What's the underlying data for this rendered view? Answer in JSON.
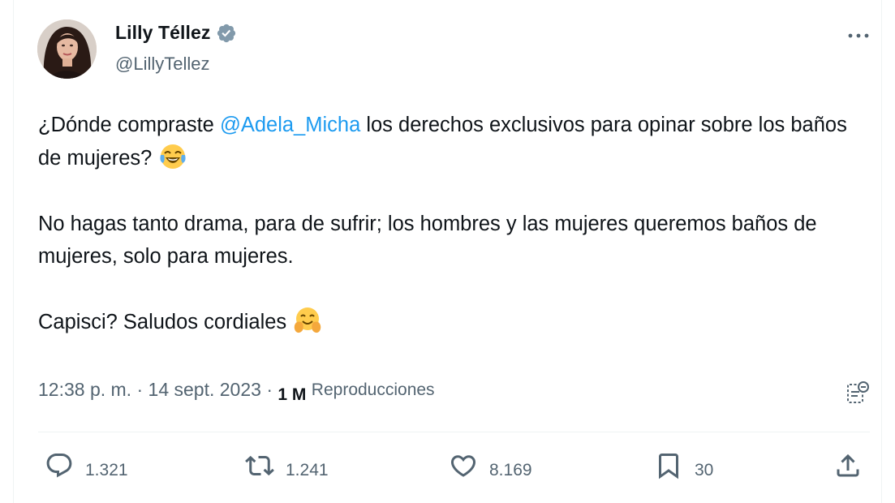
{
  "author": {
    "display_name": "Lilly Téllez",
    "handle": "@LillyTellez",
    "avatar_icon": "profile-photo",
    "verified_icon": "verified-badge-icon"
  },
  "tweet": {
    "p1_before": "¿Dónde compraste ",
    "p1_mention": "@Adela_Micha",
    "p1_after": " los derechos exclusivos para opinar sobre los baños de mujeres?",
    "p1_emoji": "face-with-tears-of-joy",
    "p2": "No hagas tanto drama, para de sufrir; los hombres y las mujeres queremos baños de mujeres, solo para mujeres.",
    "p3": "Capisci? Saludos cordiales",
    "p3_emoji": "hugging-face"
  },
  "meta": {
    "time": "12:38 p. m.",
    "separator": " · ",
    "date": "14 sept. 2023",
    "views_count": "1 M",
    "views_label": "Reproducciones"
  },
  "actions": {
    "replies": "1.321",
    "retweets": "1.241",
    "likes": "8.169",
    "bookmarks": "30"
  },
  "colors": {
    "link": "#1d9bf0",
    "text": "#0f1419",
    "muted": "#536471",
    "divider": "#eff3f4"
  }
}
